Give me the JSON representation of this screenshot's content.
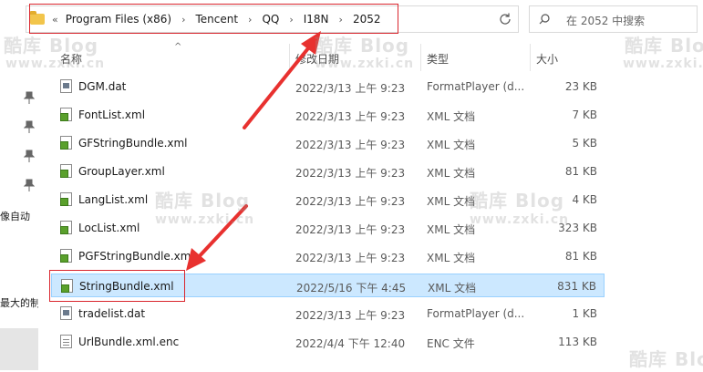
{
  "address_bar": {
    "more": "«",
    "crumbs": [
      "Program Files (x86)",
      "Tencent",
      "QQ",
      "I18N",
      "2052"
    ]
  },
  "search": {
    "placeholder": "在 2052 中搜索"
  },
  "nav": {
    "label_1": "像自动",
    "label_2": "最大的制"
  },
  "columns": {
    "name": "名称",
    "date": "修改日期",
    "type": "类型",
    "size": "大小"
  },
  "files": [
    {
      "name": "DGM.dat",
      "date": "2022/3/13 上午 9:23",
      "type": "FormatPlayer (d...",
      "size": "23 KB",
      "icon": "dat-file-icon"
    },
    {
      "name": "FontList.xml",
      "date": "2022/3/13 上午 9:23",
      "type": "XML 文档",
      "size": "7 KB",
      "icon": "xml-file-icon"
    },
    {
      "name": "GFStringBundle.xml",
      "date": "2022/3/13 上午 9:23",
      "type": "XML 文档",
      "size": "5 KB",
      "icon": "xml-file-icon"
    },
    {
      "name": "GroupLayer.xml",
      "date": "2022/3/13 上午 9:23",
      "type": "XML 文档",
      "size": "81 KB",
      "icon": "xml-file-icon"
    },
    {
      "name": "LangList.xml",
      "date": "2022/3/13 上午 9:23",
      "type": "XML 文档",
      "size": "4 KB",
      "icon": "xml-file-icon"
    },
    {
      "name": "LocList.xml",
      "date": "2022/3/13 上午 9:23",
      "type": "XML 文档",
      "size": "323 KB",
      "icon": "xml-file-icon"
    },
    {
      "name": "PGFStringBundle.xml",
      "date": "2022/3/13 上午 9:23",
      "type": "XML 文档",
      "size": "81 KB",
      "icon": "xml-file-icon"
    },
    {
      "name": "StringBundle.xml",
      "date": "2022/5/16 下午 4:45",
      "type": "XML 文档",
      "size": "831 KB",
      "icon": "xml-file-icon",
      "selected": true
    },
    {
      "name": "tradelist.dat",
      "date": "2022/3/13 上午 9:23",
      "type": "FormatPlayer (d...",
      "size": "1 KB",
      "icon": "dat-file-icon"
    },
    {
      "name": "UrlBundle.xml.enc",
      "date": "2022/4/4 下午 12:40",
      "type": "ENC 文件",
      "size": "113 KB",
      "icon": "enc-file-icon"
    }
  ],
  "watermark": {
    "brand": "酷库 Blog",
    "url": "www.zxki.cn"
  },
  "colors": {
    "highlight_red": "#d9262e",
    "selection_blue": "#cce8ff",
    "folder_yellow": "#f2c54b"
  }
}
